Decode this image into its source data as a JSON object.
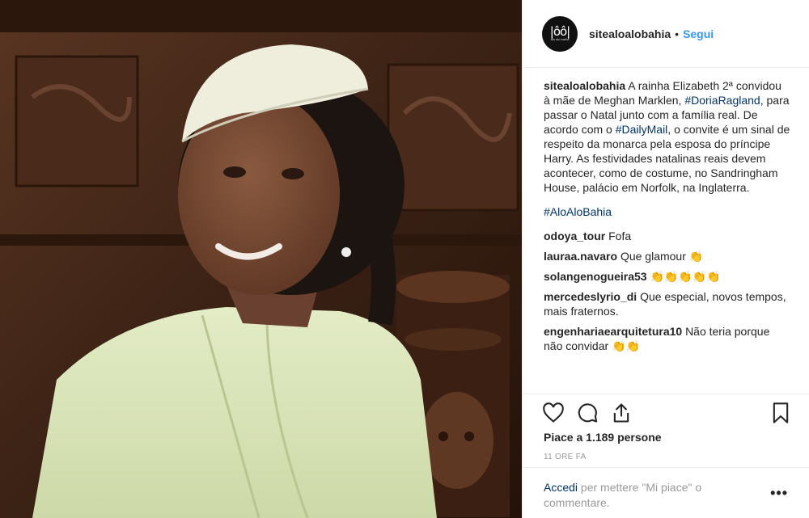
{
  "post": {
    "username": "sitealoalobahia",
    "follow_label": "Segui",
    "avatar": {
      "glyph": "|ôô|",
      "small_text": "alo alo bahia"
    }
  },
  "caption": {
    "username": "sitealoalobahia",
    "part1": "A rainha Elizabeth 2ª convidou à mãe de Meghan Marklen, ",
    "tag1": "#DoriaRagland",
    "part2": ", para passar o Natal junto com a família real. De acordo com o ",
    "tag2": "#DailyMail",
    "part3": ", o convite é um sinal de respeito da monarca pela esposa do príncipe Harry. As festividades natalinas reais devem acontecer, como de costume, no Sandringham House, palácio em Norfolk, na Inglaterra.",
    "hashtag": "#AloAloBahia"
  },
  "comments": [
    {
      "user": "odoya_tour",
      "text": "Fofa"
    },
    {
      "user": "lauraa.navaro",
      "text": "Que glamour 👏"
    },
    {
      "user": "solangenogueira53",
      "text": "👏👏👏👏👏"
    },
    {
      "user": "mercedeslyrio_di",
      "text": "Que especial, novos tempos, mais fraternos."
    },
    {
      "user": "engenhariaearquitetura10",
      "text": "Não teria porque não convidar 👏👏"
    }
  ],
  "icons": [
    "heart-icon",
    "comment-icon",
    "share-icon",
    "bookmark-icon",
    "more-icon"
  ],
  "likes": "Piace a 1.189 persone",
  "time": "11 ORE FA",
  "login": {
    "link": "Accedi",
    "text": " per mettere \"Mi piace\" o commentare."
  },
  "more_label": "•••",
  "colors": {
    "link_blue": "#3897f0",
    "hashtag": "#003569",
    "muted": "#999999",
    "border": "#efefef"
  }
}
